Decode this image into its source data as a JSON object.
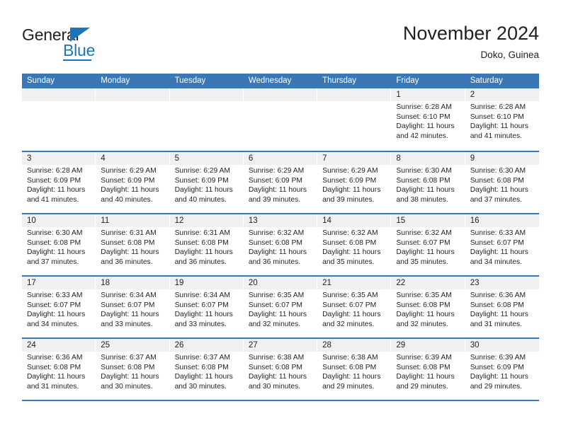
{
  "brand": {
    "name_dark": "General",
    "name_blue": "Blue",
    "accent_color": "#1b75bb"
  },
  "header": {
    "title": "November 2024",
    "location": "Doko, Guinea",
    "header_bg_color": "#3a77b5",
    "daynum_bg_color": "#f0f0f0"
  },
  "calendar": {
    "weekdays": [
      "Sunday",
      "Monday",
      "Tuesday",
      "Wednesday",
      "Thursday",
      "Friday",
      "Saturday"
    ],
    "weeks": [
      [
        {
          "day": "",
          "sunrise": "",
          "sunset": "",
          "daylight": "",
          "daylight2": ""
        },
        {
          "day": "",
          "sunrise": "",
          "sunset": "",
          "daylight": "",
          "daylight2": ""
        },
        {
          "day": "",
          "sunrise": "",
          "sunset": "",
          "daylight": "",
          "daylight2": ""
        },
        {
          "day": "",
          "sunrise": "",
          "sunset": "",
          "daylight": "",
          "daylight2": ""
        },
        {
          "day": "",
          "sunrise": "",
          "sunset": "",
          "daylight": "",
          "daylight2": ""
        },
        {
          "day": "1",
          "sunrise": "Sunrise: 6:28 AM",
          "sunset": "Sunset: 6:10 PM",
          "daylight": "Daylight: 11 hours",
          "daylight2": "and 42 minutes."
        },
        {
          "day": "2",
          "sunrise": "Sunrise: 6:28 AM",
          "sunset": "Sunset: 6:10 PM",
          "daylight": "Daylight: 11 hours",
          "daylight2": "and 41 minutes."
        }
      ],
      [
        {
          "day": "3",
          "sunrise": "Sunrise: 6:28 AM",
          "sunset": "Sunset: 6:09 PM",
          "daylight": "Daylight: 11 hours",
          "daylight2": "and 41 minutes."
        },
        {
          "day": "4",
          "sunrise": "Sunrise: 6:29 AM",
          "sunset": "Sunset: 6:09 PM",
          "daylight": "Daylight: 11 hours",
          "daylight2": "and 40 minutes."
        },
        {
          "day": "5",
          "sunrise": "Sunrise: 6:29 AM",
          "sunset": "Sunset: 6:09 PM",
          "daylight": "Daylight: 11 hours",
          "daylight2": "and 40 minutes."
        },
        {
          "day": "6",
          "sunrise": "Sunrise: 6:29 AM",
          "sunset": "Sunset: 6:09 PM",
          "daylight": "Daylight: 11 hours",
          "daylight2": "and 39 minutes."
        },
        {
          "day": "7",
          "sunrise": "Sunrise: 6:29 AM",
          "sunset": "Sunset: 6:09 PM",
          "daylight": "Daylight: 11 hours",
          "daylight2": "and 39 minutes."
        },
        {
          "day": "8",
          "sunrise": "Sunrise: 6:30 AM",
          "sunset": "Sunset: 6:08 PM",
          "daylight": "Daylight: 11 hours",
          "daylight2": "and 38 minutes."
        },
        {
          "day": "9",
          "sunrise": "Sunrise: 6:30 AM",
          "sunset": "Sunset: 6:08 PM",
          "daylight": "Daylight: 11 hours",
          "daylight2": "and 37 minutes."
        }
      ],
      [
        {
          "day": "10",
          "sunrise": "Sunrise: 6:30 AM",
          "sunset": "Sunset: 6:08 PM",
          "daylight": "Daylight: 11 hours",
          "daylight2": "and 37 minutes."
        },
        {
          "day": "11",
          "sunrise": "Sunrise: 6:31 AM",
          "sunset": "Sunset: 6:08 PM",
          "daylight": "Daylight: 11 hours",
          "daylight2": "and 36 minutes."
        },
        {
          "day": "12",
          "sunrise": "Sunrise: 6:31 AM",
          "sunset": "Sunset: 6:08 PM",
          "daylight": "Daylight: 11 hours",
          "daylight2": "and 36 minutes."
        },
        {
          "day": "13",
          "sunrise": "Sunrise: 6:32 AM",
          "sunset": "Sunset: 6:08 PM",
          "daylight": "Daylight: 11 hours",
          "daylight2": "and 36 minutes."
        },
        {
          "day": "14",
          "sunrise": "Sunrise: 6:32 AM",
          "sunset": "Sunset: 6:08 PM",
          "daylight": "Daylight: 11 hours",
          "daylight2": "and 35 minutes."
        },
        {
          "day": "15",
          "sunrise": "Sunrise: 6:32 AM",
          "sunset": "Sunset: 6:07 PM",
          "daylight": "Daylight: 11 hours",
          "daylight2": "and 35 minutes."
        },
        {
          "day": "16",
          "sunrise": "Sunrise: 6:33 AM",
          "sunset": "Sunset: 6:07 PM",
          "daylight": "Daylight: 11 hours",
          "daylight2": "and 34 minutes."
        }
      ],
      [
        {
          "day": "17",
          "sunrise": "Sunrise: 6:33 AM",
          "sunset": "Sunset: 6:07 PM",
          "daylight": "Daylight: 11 hours",
          "daylight2": "and 34 minutes."
        },
        {
          "day": "18",
          "sunrise": "Sunrise: 6:34 AM",
          "sunset": "Sunset: 6:07 PM",
          "daylight": "Daylight: 11 hours",
          "daylight2": "and 33 minutes."
        },
        {
          "day": "19",
          "sunrise": "Sunrise: 6:34 AM",
          "sunset": "Sunset: 6:07 PM",
          "daylight": "Daylight: 11 hours",
          "daylight2": "and 33 minutes."
        },
        {
          "day": "20",
          "sunrise": "Sunrise: 6:35 AM",
          "sunset": "Sunset: 6:07 PM",
          "daylight": "Daylight: 11 hours",
          "daylight2": "and 32 minutes."
        },
        {
          "day": "21",
          "sunrise": "Sunrise: 6:35 AM",
          "sunset": "Sunset: 6:07 PM",
          "daylight": "Daylight: 11 hours",
          "daylight2": "and 32 minutes."
        },
        {
          "day": "22",
          "sunrise": "Sunrise: 6:35 AM",
          "sunset": "Sunset: 6:08 PM",
          "daylight": "Daylight: 11 hours",
          "daylight2": "and 32 minutes."
        },
        {
          "day": "23",
          "sunrise": "Sunrise: 6:36 AM",
          "sunset": "Sunset: 6:08 PM",
          "daylight": "Daylight: 11 hours",
          "daylight2": "and 31 minutes."
        }
      ],
      [
        {
          "day": "24",
          "sunrise": "Sunrise: 6:36 AM",
          "sunset": "Sunset: 6:08 PM",
          "daylight": "Daylight: 11 hours",
          "daylight2": "and 31 minutes."
        },
        {
          "day": "25",
          "sunrise": "Sunrise: 6:37 AM",
          "sunset": "Sunset: 6:08 PM",
          "daylight": "Daylight: 11 hours",
          "daylight2": "and 30 minutes."
        },
        {
          "day": "26",
          "sunrise": "Sunrise: 6:37 AM",
          "sunset": "Sunset: 6:08 PM",
          "daylight": "Daylight: 11 hours",
          "daylight2": "and 30 minutes."
        },
        {
          "day": "27",
          "sunrise": "Sunrise: 6:38 AM",
          "sunset": "Sunset: 6:08 PM",
          "daylight": "Daylight: 11 hours",
          "daylight2": "and 30 minutes."
        },
        {
          "day": "28",
          "sunrise": "Sunrise: 6:38 AM",
          "sunset": "Sunset: 6:08 PM",
          "daylight": "Daylight: 11 hours",
          "daylight2": "and 29 minutes."
        },
        {
          "day": "29",
          "sunrise": "Sunrise: 6:39 AM",
          "sunset": "Sunset: 6:08 PM",
          "daylight": "Daylight: 11 hours",
          "daylight2": "and 29 minutes."
        },
        {
          "day": "30",
          "sunrise": "Sunrise: 6:39 AM",
          "sunset": "Sunset: 6:09 PM",
          "daylight": "Daylight: 11 hours",
          "daylight2": "and 29 minutes."
        }
      ]
    ]
  }
}
